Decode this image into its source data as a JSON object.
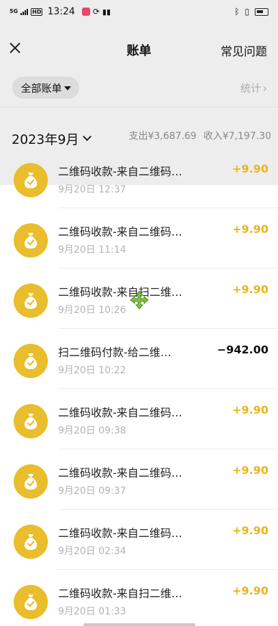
{
  "status_bar": {
    "signal": "5G",
    "time": "13:24",
    "hd": "HD"
  },
  "nav": {
    "title": "账单",
    "faq": "常见问题"
  },
  "filter": {
    "label": "全部账单",
    "stats_label": "统计",
    "stats_arrow": "›"
  },
  "month_bar": {
    "month": "2023年9月",
    "expense": "支出¥3,687.69",
    "income": "收入¥7,197.30"
  },
  "transactions": [
    {
      "title": "二维码收款-来自二维码…",
      "time": "9月20日 12:37",
      "amount": "+9.90",
      "direction": "in"
    },
    {
      "title": "二维码收款-来自二维码…",
      "time": "9月20日 11:14",
      "amount": "+9.90",
      "direction": "in"
    },
    {
      "title": "二维码收款-来自扫二维…",
      "time": "9月20日 10:26",
      "amount": "+9.90",
      "direction": "in"
    },
    {
      "title": "扫二维码付款-给二维…",
      "time": "9月20日 10:22",
      "amount": "−942.00",
      "direction": "out"
    },
    {
      "title": "二维码收款-来自二维码…",
      "time": "9月20日 09:38",
      "amount": "+9.90",
      "direction": "in"
    },
    {
      "title": "二维码收款-来自二维码…",
      "time": "9月20日 09:37",
      "amount": "+9.90",
      "direction": "in"
    },
    {
      "title": "二维码收款-来自二维码…",
      "time": "9月20日 02:34",
      "amount": "+9.90",
      "direction": "in"
    },
    {
      "title": "二维码收款-来自扫二维…",
      "time": "9月20日 01:33",
      "amount": "+9.90",
      "direction": "in"
    }
  ],
  "colors": {
    "accent": "#e9bd2b",
    "income_text": "#e9b51c",
    "background_header": "#ededed"
  },
  "icons": {
    "close": "close-icon",
    "row": "money-bag-icon",
    "cursor": "move-cursor-icon"
  }
}
